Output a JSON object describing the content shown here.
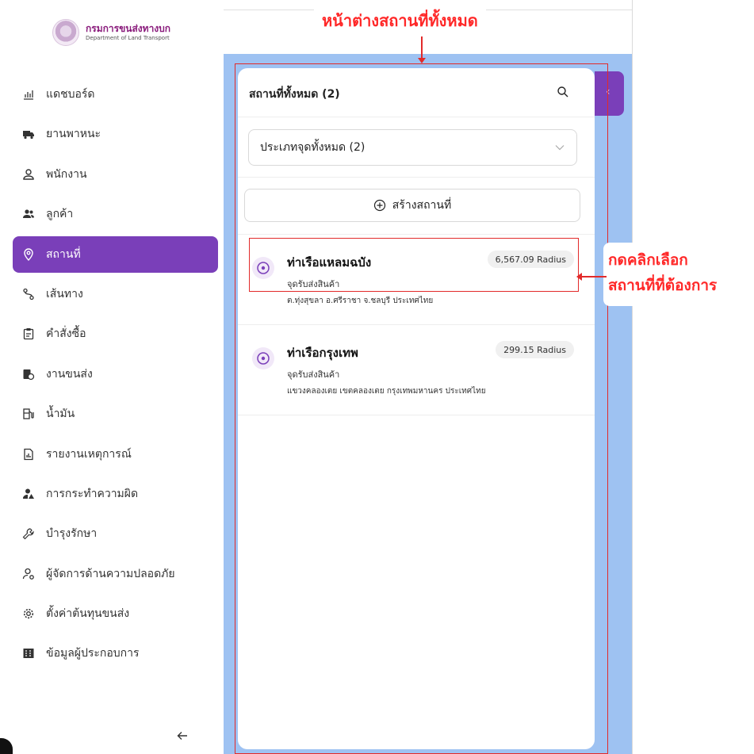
{
  "brand": {
    "name_th": "กรมการขนส่งทางบก",
    "name_en": "Department of Land Transport"
  },
  "sidebar": {
    "items": [
      {
        "label": "แดชบอร์ด",
        "icon": "chart-icon"
      },
      {
        "label": "ยานพาหนะ",
        "icon": "truck-icon"
      },
      {
        "label": "พนักงาน",
        "icon": "user-icon"
      },
      {
        "label": "ลูกค้า",
        "icon": "users-icon"
      },
      {
        "label": "สถานที่",
        "icon": "location-pin-icon",
        "active": true
      },
      {
        "label": "เส้นทาง",
        "icon": "route-icon"
      },
      {
        "label": "คำสั่งซื้อ",
        "icon": "clipboard-icon"
      },
      {
        "label": "งานขนส่ง",
        "icon": "delivery-icon"
      },
      {
        "label": "น้ำมัน",
        "icon": "fuel-icon"
      },
      {
        "label": "รายงานเหตุการณ์",
        "icon": "report-icon"
      },
      {
        "label": "การกระทำความผิด",
        "icon": "violation-icon"
      },
      {
        "label": "บำรุงรักษา",
        "icon": "wrench-icon"
      },
      {
        "label": "ผู้จัดการด้านความปลอดภัย",
        "icon": "safety-manager-icon"
      },
      {
        "label": "ตั้งค่าต้นทุนขนส่ง",
        "icon": "gear-icon"
      },
      {
        "label": "ข้อมูลผู้ประกอบการ",
        "icon": "building-icon"
      }
    ],
    "collapse_icon": "arrow-left-icon"
  },
  "panel": {
    "title": "สถานที่ทั้งหมด (2)",
    "filter_value": "ประเภทจุดทั้งหมด (2)",
    "create_label": "สร้างสถานที่",
    "places": [
      {
        "name": "ท่าเรือแหลมฉบัง",
        "type": "จุดรับส่งสินค้า",
        "address": "ต.ทุ่งสุขลา อ.ศรีราชา จ.ชลบุรี ประเทศไทย",
        "radius": "6,567.09 Radius"
      },
      {
        "name": "ท่าเรือกรุงเทพ",
        "type": "จุดรับส่งสินค้า",
        "address": "แขวงคลองเตย เขตคลองเตย กรุงเทพมหานคร ประเทศไทย",
        "radius": "299.15 Radius"
      }
    ]
  },
  "annotations": {
    "title": "หน้าต่างสถานที่ทั้งหมด",
    "side_line1": "กดคลิกเลือก",
    "side_line2": "สถานที่ที่ต้องการ"
  },
  "colors": {
    "accent": "#7a3fb9",
    "map": "#9ec2f2",
    "annotation": "#ff2828"
  }
}
